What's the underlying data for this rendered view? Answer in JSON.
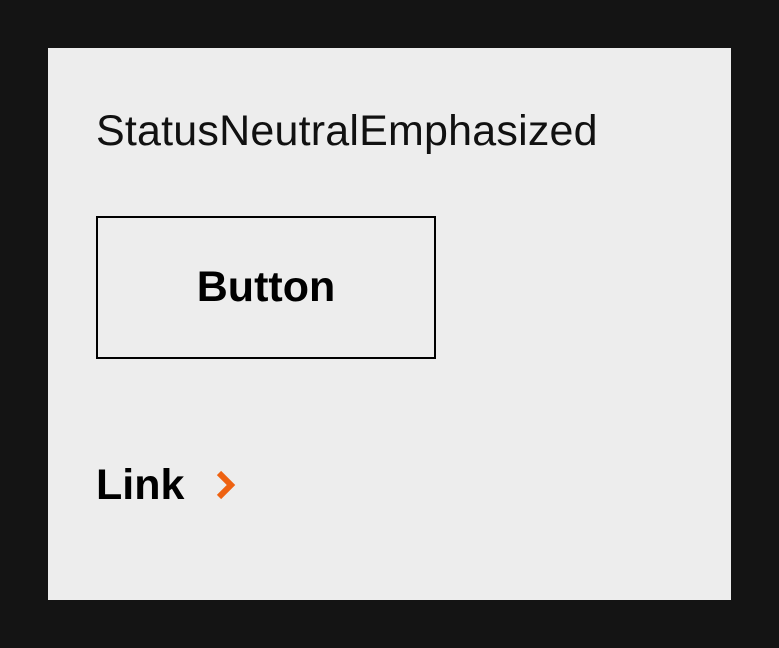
{
  "card": {
    "title": "StatusNeutralEmphasized",
    "button_label": "Button",
    "link_label": "Link",
    "link_icon": "chevron-right-icon"
  },
  "colors": {
    "page_background": "#141414",
    "card_background": "#ededed",
    "text": "#000000",
    "accent": "#ee6211"
  }
}
